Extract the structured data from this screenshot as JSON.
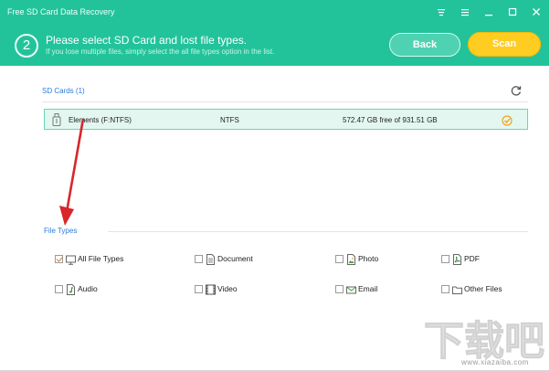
{
  "app": {
    "title": "Free SD Card Data Recovery"
  },
  "window_controls": [
    {
      "name": "menu-icon"
    },
    {
      "name": "list-icon"
    },
    {
      "name": "minimize-icon"
    },
    {
      "name": "maximize-icon"
    },
    {
      "name": "close-icon"
    }
  ],
  "header": {
    "step_number": "2",
    "title": "Please select SD Card and lost file types.",
    "subtitle": "If you lose multiple files, simply select the all file types option in the list.",
    "back_label": "Back",
    "scan_label": "Scan",
    "bg_color": "#22c39b",
    "scan_color": "#ffcc22"
  },
  "sd_cards": {
    "label": "SD Cards (1)",
    "items": [
      {
        "name": "Elements (F:NTFS)",
        "fs": "NTFS",
        "space": "572.47 GB free of 931.51 GB",
        "selected": true
      }
    ]
  },
  "file_types": {
    "label": "File Types",
    "items": [
      {
        "label": "All File Types",
        "icon": "monitor-icon",
        "checked": true
      },
      {
        "label": "Document",
        "icon": "document-icon",
        "checked": false
      },
      {
        "label": "Photo",
        "icon": "photo-icon",
        "checked": false
      },
      {
        "label": "PDF",
        "icon": "pdf-icon",
        "checked": false
      },
      {
        "label": "Audio",
        "icon": "audio-icon",
        "checked": false
      },
      {
        "label": "Video",
        "icon": "video-icon",
        "checked": false
      },
      {
        "label": "Email",
        "icon": "email-icon",
        "checked": false
      },
      {
        "label": "Other Files",
        "icon": "folder-icon",
        "checked": false
      }
    ]
  },
  "watermark": {
    "text": "下载吧",
    "url": "www.xiazaiba.com"
  }
}
